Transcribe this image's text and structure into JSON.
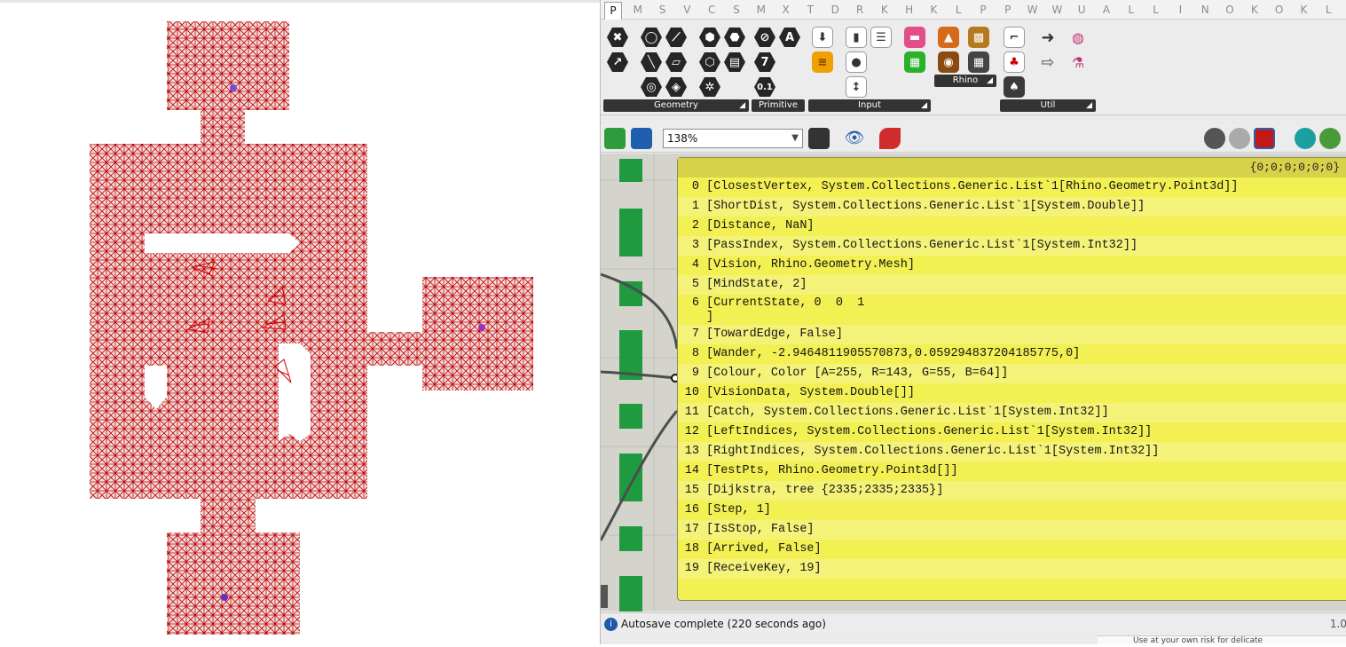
{
  "rhino_viewport": {
    "label": "rhino-viewport"
  },
  "grasshopper": {
    "tabs": [
      "P",
      "M",
      "S",
      "V",
      "C",
      "S",
      "M",
      "X",
      "T",
      "D",
      "R",
      "K",
      "H",
      "K",
      "L",
      "P",
      "P",
      "W",
      "W",
      "U",
      "A",
      "L",
      "L",
      "I",
      "N",
      "O",
      "K",
      "O",
      "K",
      "L"
    ],
    "active_tab": "P",
    "ribbon": {
      "geometry": {
        "label": "Geometry"
      },
      "primitive": {
        "label": "Primitive",
        "seven": "7",
        "decimal": "0.1"
      },
      "input": {
        "label": "Input"
      },
      "rhino": {
        "label": "Rhino"
      },
      "util": {
        "label": "Util"
      }
    },
    "toolbar": {
      "zoom": "138%"
    },
    "panel": {
      "header": "{0;0;0;0;0;0}",
      "rows": [
        {
          "i": "0",
          "v": "[ClosestVertex, System.Collections.Generic.List`1[Rhino.Geometry.Point3d]]"
        },
        {
          "i": "1",
          "v": "[ShortDist, System.Collections.Generic.List`1[System.Double]]"
        },
        {
          "i": "2",
          "v": "[Distance, NaN]"
        },
        {
          "i": "3",
          "v": "[PassIndex, System.Collections.Generic.List`1[System.Int32]]"
        },
        {
          "i": "4",
          "v": "[Vision, Rhino.Geometry.Mesh]"
        },
        {
          "i": "5",
          "v": "[MindState, 2]"
        },
        {
          "i": "6",
          "v": "[CurrentState, 0  0  1\n]"
        },
        {
          "i": "7",
          "v": "[TowardEdge, False]"
        },
        {
          "i": "8",
          "v": "[Wander, -2.9464811905570873,0.059294837204185775,0]"
        },
        {
          "i": "9",
          "v": "[Colour, Color [A=255, R=143, G=55, B=64]]"
        },
        {
          "i": "10",
          "v": "[VisionData, System.Double[]]"
        },
        {
          "i": "11",
          "v": "[Catch, System.Collections.Generic.List`1[System.Int32]]"
        },
        {
          "i": "12",
          "v": "[LeftIndices, System.Collections.Generic.List`1[System.Int32]]"
        },
        {
          "i": "13",
          "v": "[RightIndices, System.Collections.Generic.List`1[System.Int32]]"
        },
        {
          "i": "14",
          "v": "[TestPts, Rhino.Geometry.Point3d[]]"
        },
        {
          "i": "15",
          "v": "[Dijkstra, tree {2335;2335;2335}]"
        },
        {
          "i": "16",
          "v": "[Step, 1]"
        },
        {
          "i": "17",
          "v": "[IsStop, False]"
        },
        {
          "i": "18",
          "v": "[Arrived, False]"
        },
        {
          "i": "19",
          "v": "[ReceiveKey, 19]"
        }
      ]
    },
    "status": {
      "message": "Autosave complete (220 seconds ago)",
      "version": "1.0"
    },
    "bottom_text": "Use at your own risk for delicate"
  }
}
